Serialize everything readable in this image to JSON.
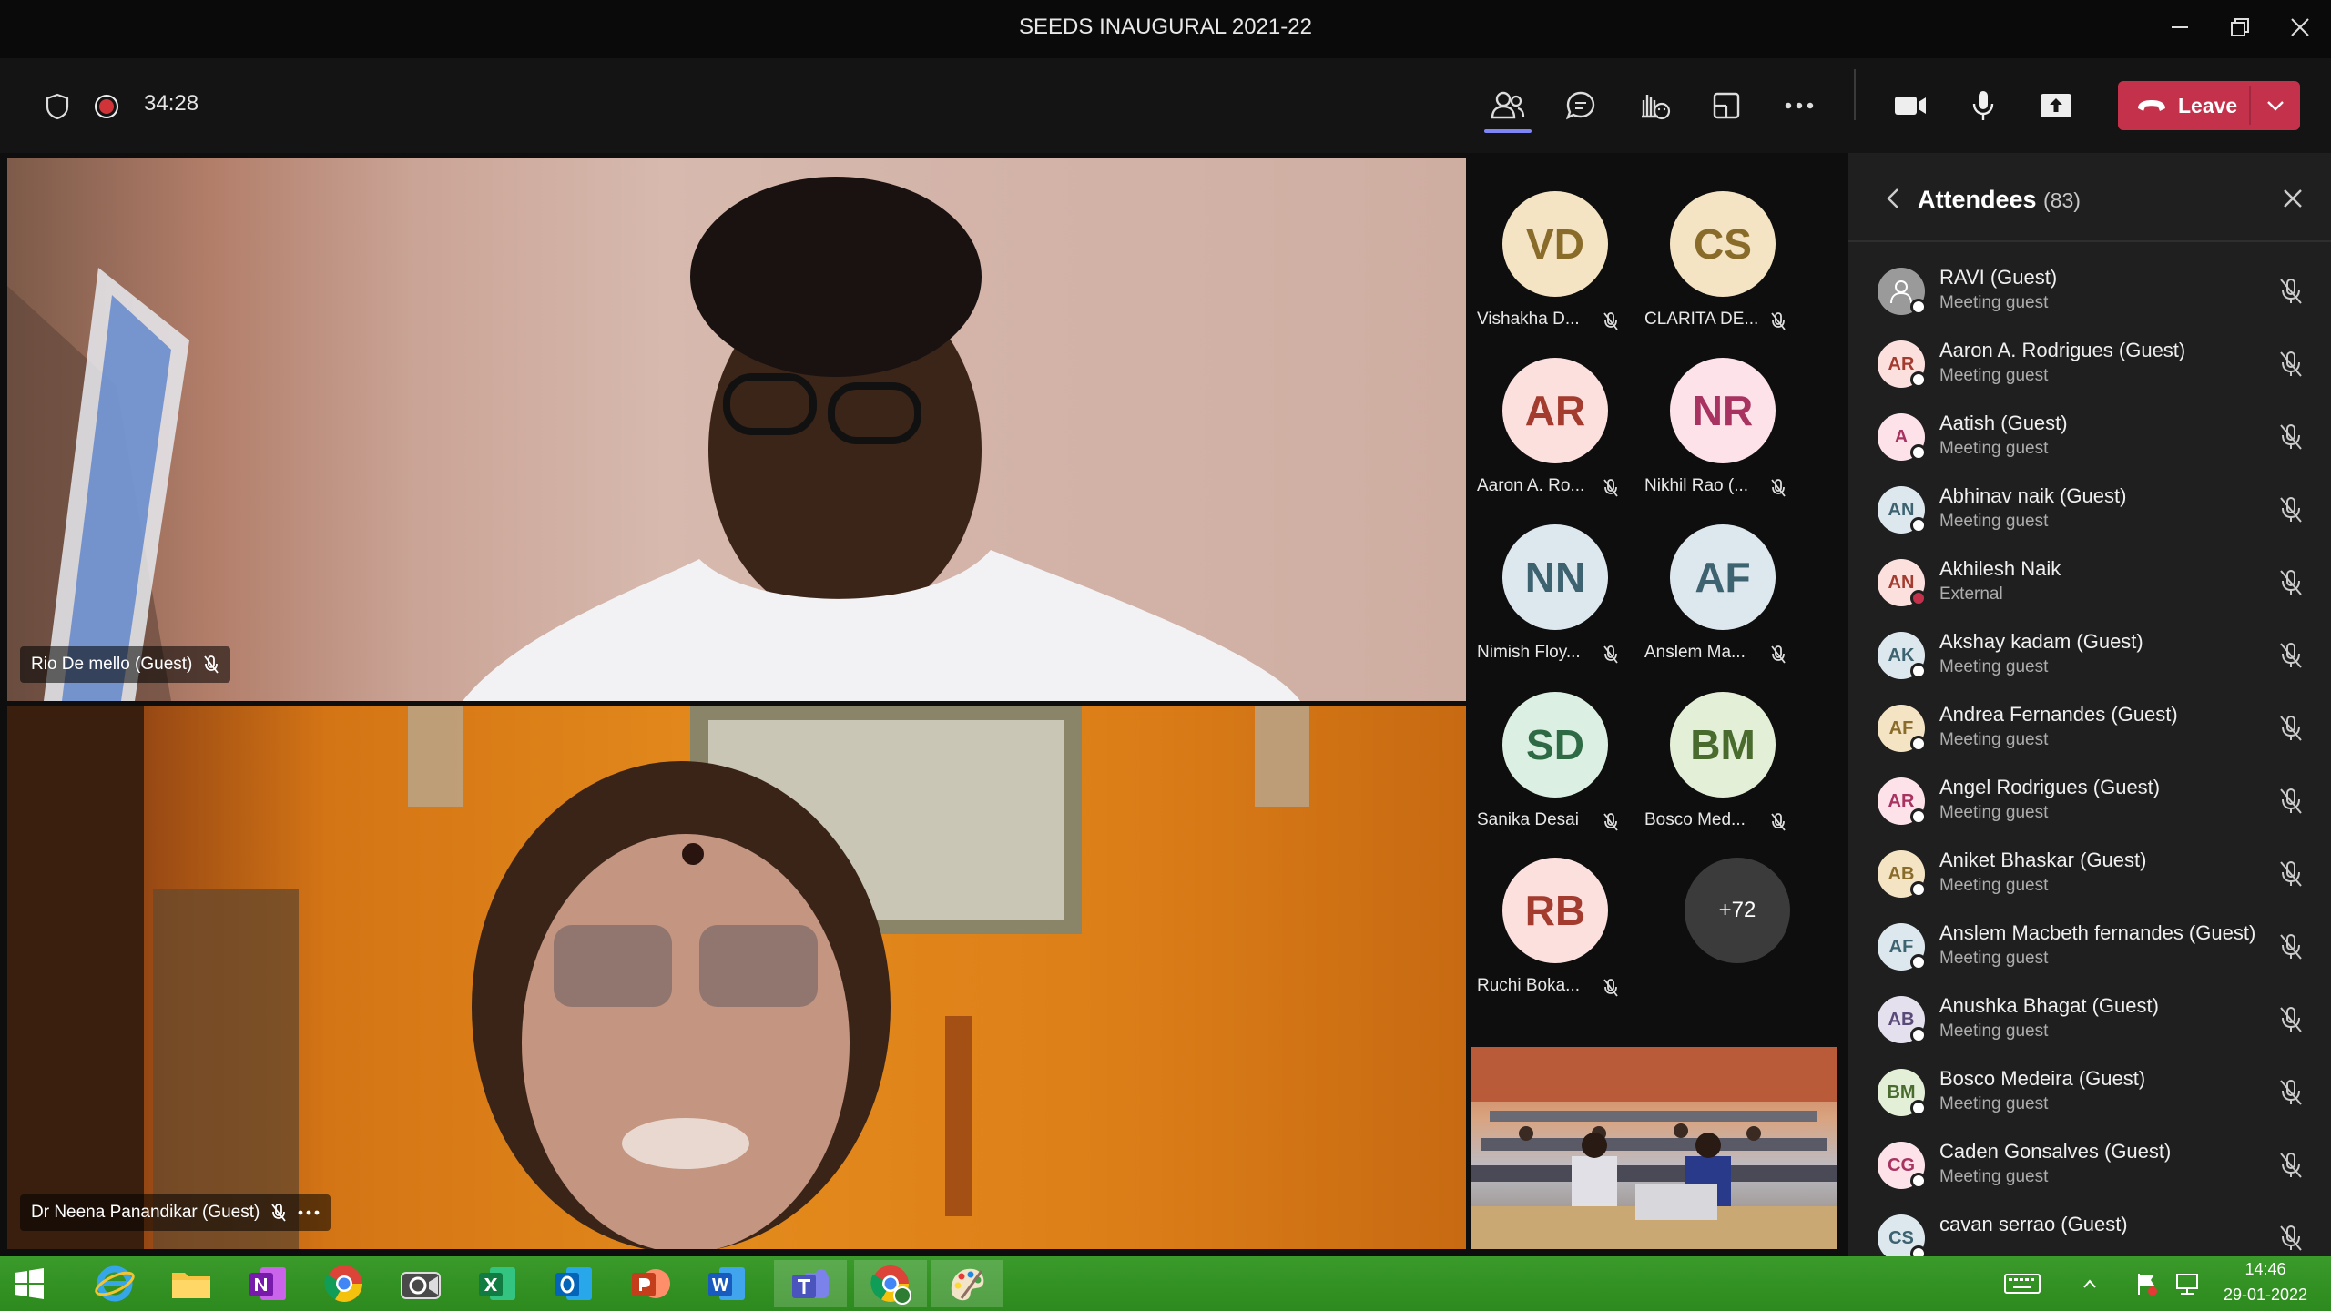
{
  "window": {
    "title": "SEEDS INAUGURAL 2021-22"
  },
  "toolbar": {
    "timer": "34:28",
    "leave_label": "Leave",
    "buttons": [
      "participants-icon",
      "chat-icon",
      "reactions-icon",
      "rooms-icon",
      "more-icon",
      "camera-icon",
      "mic-icon",
      "share-icon"
    ]
  },
  "videos": [
    {
      "name": "Rio De mello (Guest)"
    },
    {
      "name": "Dr Neena Panandikar (Guest)"
    }
  ],
  "gallery": {
    "tiles": [
      {
        "initials": "VD",
        "name": "Vishakha D...",
        "bg": "#f4e4c4",
        "fg": "#8a6c2a"
      },
      {
        "initials": "CS",
        "name": "CLARITA DE...",
        "bg": "#f4e4c4",
        "fg": "#8a6c2a"
      },
      {
        "initials": "AR",
        "name": "Aaron A. Ro...",
        "bg": "#fbe0de",
        "fg": "#a33b2e"
      },
      {
        "initials": "NR",
        "name": "Nikhil Rao (...",
        "bg": "#fde2ea",
        "fg": "#a83360"
      },
      {
        "initials": "NN",
        "name": "Nimish Floy...",
        "bg": "#dde8ee",
        "fg": "#3d6270"
      },
      {
        "initials": "AF",
        "name": "Anslem Ma...",
        "bg": "#dde8ee",
        "fg": "#3d6270"
      },
      {
        "initials": "SD",
        "name": "Sanika Desai",
        "bg": "#dcefe3",
        "fg": "#2e6b45"
      },
      {
        "initials": "BM",
        "name": "Bosco Med...",
        "bg": "#e4efd8",
        "fg": "#4a6b2e"
      },
      {
        "initials": "RB",
        "name": "Ruchi Boka...",
        "bg": "#fbe0de",
        "fg": "#a33b2e"
      }
    ],
    "overflow": "+72"
  },
  "panel": {
    "title": "Attendees",
    "count": "(83)",
    "attendees": [
      {
        "name": "RAVI (Guest)",
        "role": "Meeting guest",
        "initials": "",
        "bg": "#9a9a9a",
        "fg": "#ffffff",
        "status": "#ffffff"
      },
      {
        "name": "Aaron A. Rodrigues (Guest)",
        "role": "Meeting guest",
        "initials": "AR",
        "bg": "#fbe0de",
        "fg": "#a33b2e",
        "status": "#ffffff"
      },
      {
        "name": "Aatish (Guest)",
        "role": "Meeting guest",
        "initials": "A",
        "bg": "#fde2ea",
        "fg": "#a83360",
        "status": "#ffffff"
      },
      {
        "name": "Abhinav naik (Guest)",
        "role": "Meeting guest",
        "initials": "AN",
        "bg": "#dde8ee",
        "fg": "#3d6270",
        "status": "#ffffff"
      },
      {
        "name": "Akhilesh Naik",
        "role": "External",
        "initials": "AN",
        "bg": "#fbe0de",
        "fg": "#a33b2e",
        "status": "#c4314b"
      },
      {
        "name": "Akshay kadam (Guest)",
        "role": "Meeting guest",
        "initials": "AK",
        "bg": "#dde8ee",
        "fg": "#3d6270",
        "status": "#ffffff"
      },
      {
        "name": "Andrea Fernandes (Guest)",
        "role": "Meeting guest",
        "initials": "AF",
        "bg": "#f4e4c4",
        "fg": "#8a6c2a",
        "status": "#ffffff"
      },
      {
        "name": "Angel Rodrigues (Guest)",
        "role": "Meeting guest",
        "initials": "AR",
        "bg": "#fde2ea",
        "fg": "#a83360",
        "status": "#ffffff"
      },
      {
        "name": "Aniket Bhaskar (Guest)",
        "role": "Meeting guest",
        "initials": "AB",
        "bg": "#f4e4c4",
        "fg": "#8a6c2a",
        "status": "#ffffff"
      },
      {
        "name": "Anslem Macbeth fernandes (Guest)",
        "role": "Meeting guest",
        "initials": "AF",
        "bg": "#dde8ee",
        "fg": "#3d6270",
        "status": "#ffffff"
      },
      {
        "name": "Anushka Bhagat (Guest)",
        "role": "Meeting guest",
        "initials": "AB",
        "bg": "#e5e0ee",
        "fg": "#5a4a78",
        "status": "#ffffff"
      },
      {
        "name": "Bosco Medeira (Guest)",
        "role": "Meeting guest",
        "initials": "BM",
        "bg": "#e4efd8",
        "fg": "#4a6b2e",
        "status": "#ffffff"
      },
      {
        "name": "Caden Gonsalves (Guest)",
        "role": "Meeting guest",
        "initials": "CG",
        "bg": "#fde2ea",
        "fg": "#a83360",
        "status": "#ffffff"
      },
      {
        "name": "cavan serrao (Guest)",
        "role": "",
        "initials": "CS",
        "bg": "#dde8ee",
        "fg": "#3d6270",
        "status": "#ffffff"
      }
    ]
  },
  "taskbar": {
    "apps": [
      "start-icon",
      "internet-explorer-icon",
      "file-explorer-icon",
      "onenote-icon",
      "chrome-icon",
      "camera-app-icon",
      "excel-icon",
      "outlook-icon",
      "powerpoint-icon",
      "word-icon",
      "teams-icon",
      "chrome-profile-icon",
      "paint-icon"
    ],
    "time": "14:46",
    "date": "29-01-2022"
  }
}
